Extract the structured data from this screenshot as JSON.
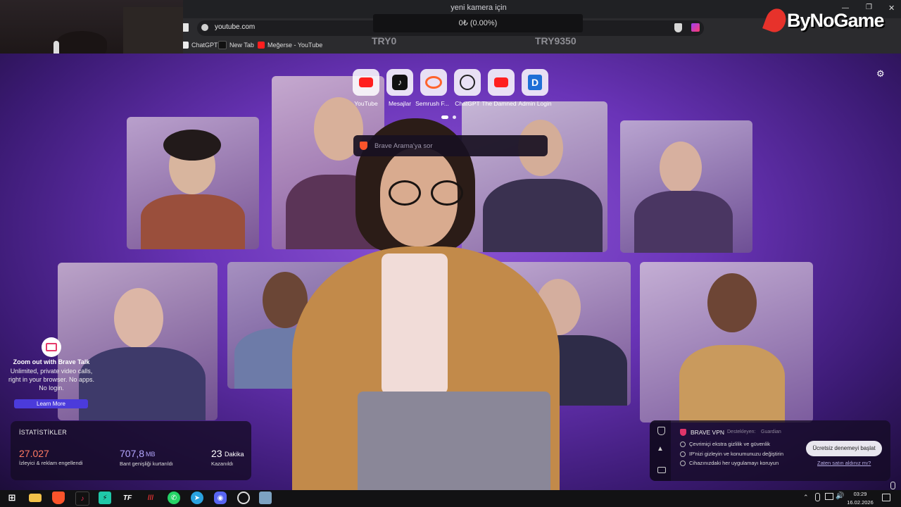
{
  "window": {
    "title": "yeni kamera için"
  },
  "overlay": {
    "speed": "0₺ (0.00%)",
    "left_label": "TRY0",
    "right_label": "TRY9350"
  },
  "watermark": {
    "brand": "ByNoGame"
  },
  "address_bar": {
    "url": "youtube.com"
  },
  "bookmarks": [
    {
      "label": "ChatGPT",
      "icon": "chatgpt-icon"
    },
    {
      "label": "New Tab",
      "icon": "tiktok-icon"
    },
    {
      "label": "Meğerse - YouTube",
      "icon": "youtube-icon"
    }
  ],
  "top_sites": [
    {
      "label": "YouTube",
      "icon": "youtube-icon"
    },
    {
      "label": "Mesajlar",
      "icon": "tiktok-icon"
    },
    {
      "label": "Semrush F...",
      "icon": "semrush-icon"
    },
    {
      "label": "ChatGPT",
      "icon": "chatgpt-icon"
    },
    {
      "label": "The Damned",
      "icon": "youtube-icon"
    },
    {
      "label": "Admin Login",
      "icon": "d-logo-icon"
    }
  ],
  "search": {
    "placeholder": "Brave Arama'ya sor"
  },
  "brave_talk": {
    "title": "Zoom out with Brave Talk",
    "body": "Unlimited, private video calls, right in your browser. No apps. No login.",
    "button": "Learn More"
  },
  "stats": {
    "title": "İSTATİSTİKLER",
    "blocked_value": "27.027",
    "blocked_label": "İzleyici & reklam engellendi",
    "bandwidth_value": "707,8",
    "bandwidth_unit": "MB",
    "bandwidth_label": "Bant genişliği kurtarıldı",
    "time_value": "23",
    "time_unit": "Dakika",
    "time_label": "Kazanıldı"
  },
  "vpn": {
    "title": "BRAVE VPN",
    "powered_by": "Destekleyen:",
    "partner": "Guardian",
    "features": [
      "Çevrimiçi ekstra gizlilik ve güvenlik",
      "IP'nizi gizleyin ve konumunuzu değiştirin",
      "Cihazınızdaki her uygulamayı koruyun"
    ],
    "trial_button": "Ücretsiz denemeyi başlat",
    "already_link": "Zaten satın aldınız mı?"
  },
  "taskbar": {
    "time": "03:29",
    "date": "16.02.2026",
    "apps": [
      "windows-start-icon",
      "file-explorer-icon",
      "brave-icon",
      "tiktok-icon",
      "green-app-icon",
      "tf-icon",
      "red-app-icon",
      "whatsapp-icon",
      "telegram-icon",
      "discord-icon",
      "obs-icon",
      "photo-app-icon"
    ]
  },
  "colors": {
    "accent_purple": "#7b3fd1",
    "learn_more": "#4b3bdb",
    "trial_button": "#e8e6ee"
  }
}
